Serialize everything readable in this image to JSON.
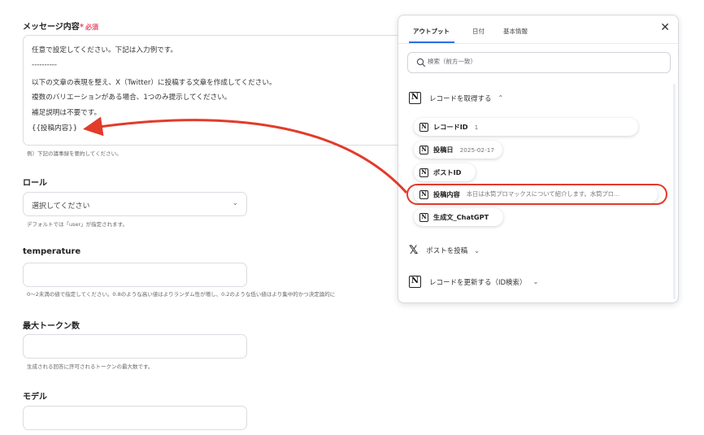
{
  "message_section": {
    "label": "メッセージ内容",
    "required_star": "*",
    "required_text": "必須",
    "lines": [
      "任意で設定してください。下記は入力例です。",
      "----------",
      "以下の文章の表現を整え、X（Twitter）に投稿する文章を作成してください。",
      "複数のバリエーションがある場合、1つのみ提示してください。",
      "補足説明は不要です。",
      "{{投稿内容}}"
    ],
    "help": "例）下記の議事録を要約してください。"
  },
  "role_section": {
    "label": "ロール",
    "select_value": "選択してください",
    "help": "デフォルトでは「user」が指定されます。"
  },
  "temperature_section": {
    "label": "temperature",
    "value": "",
    "help": "0〜2未満の値で指定してください。0.8のような高い値はよりランダム性が増し、0.2のような低い値はより集中的かつ決定論的に"
  },
  "max_tokens_section": {
    "label": "最大トークン数",
    "value": "",
    "help": "生成される回答に許可されるトークンの最大数です。"
  },
  "model_section": {
    "label": "モデル",
    "value": ""
  },
  "panel": {
    "tabs": [
      "アウトプット",
      "日付",
      "基本情報"
    ],
    "search_placeholder": "検索（前方一致）",
    "groups": [
      {
        "label": "レコードを取得する",
        "icon": "notion-icon",
        "expanded": true,
        "items": [
          {
            "name": "レコードID",
            "value": "1"
          },
          {
            "name": "投稿日",
            "value": "2025-02-17"
          },
          {
            "name": "ポストID",
            "value": ""
          },
          {
            "name": "投稿内容",
            "value": "本日は水筒プロマックスについて紹介します。水筒プロ…"
          },
          {
            "name": "生成文_ChatGPT",
            "value": ""
          }
        ]
      },
      {
        "label": "ポストを投稿",
        "icon": "x-icon",
        "expanded": false
      },
      {
        "label": "レコードを更新する（ID検索）",
        "icon": "notion-icon",
        "expanded": false
      }
    ]
  },
  "colors": {
    "accent": "#2f6fe4",
    "highlight": "#e23b2a",
    "required": "#e84b6a"
  }
}
